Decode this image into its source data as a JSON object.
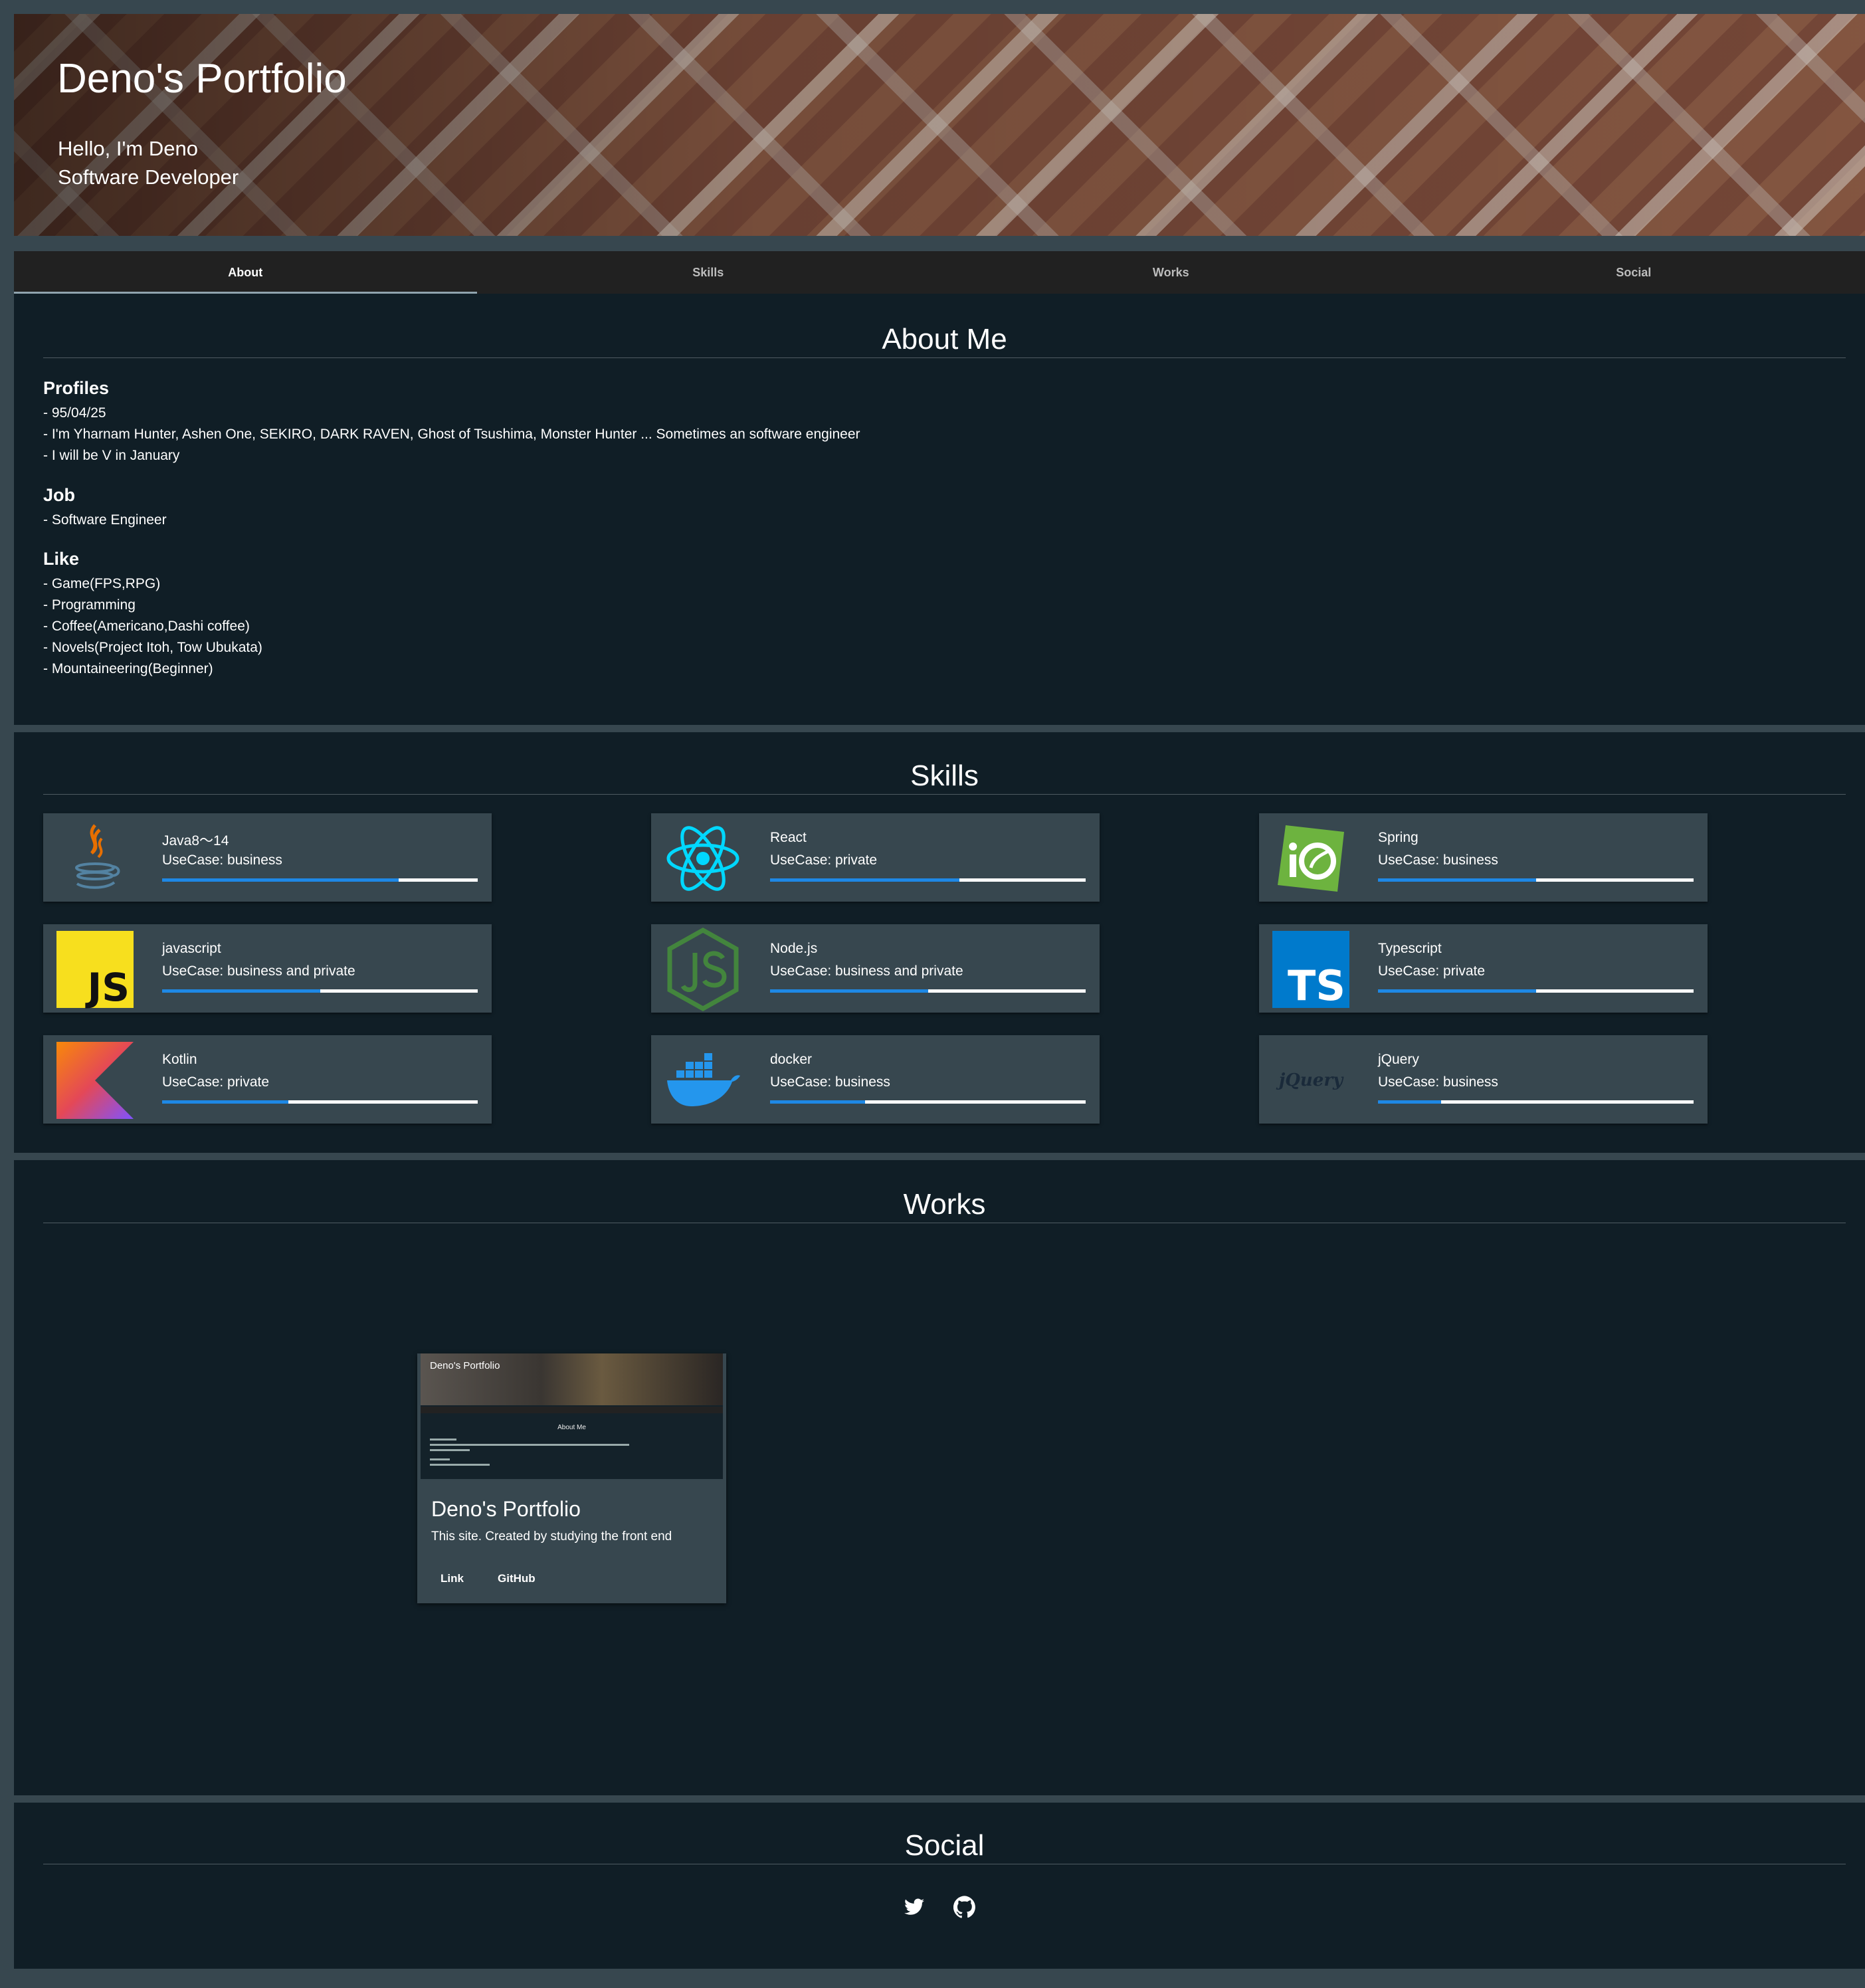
{
  "hero": {
    "title": "Deno's Portfolio",
    "greeting": "Hello, I'm Deno",
    "role": "Software Developer"
  },
  "tabs": [
    {
      "label": "About",
      "active": true
    },
    {
      "label": "Skills",
      "active": false
    },
    {
      "label": "Works",
      "active": false
    },
    {
      "label": "Social",
      "active": false
    }
  ],
  "about": {
    "title": "About Me",
    "profiles": {
      "heading": "Profiles",
      "lines": [
        "- 95/04/25",
        "- I'm Yharnam Hunter, Ashen One, SEKIRO, DARK RAVEN, Ghost of Tsushima, Monster Hunter ... Sometimes an software engineer",
        "- I will be V in January"
      ]
    },
    "job": {
      "heading": "Job",
      "lines": [
        "- Software Engineer"
      ]
    },
    "like": {
      "heading": "Like",
      "lines": [
        "- Game(FPS,RPG)",
        "- Programming",
        "- Coffee(Americano,Dashi coffee)",
        "- Novels(Project Itoh, Tow Ubukata)",
        "- Mountaineering(Beginner)"
      ]
    }
  },
  "skills": {
    "title": "Skills",
    "items": [
      {
        "name": "Java8〜14",
        "usecase": "UseCase: business",
        "level": 0.75,
        "icon": "java-icon"
      },
      {
        "name": "React",
        "usecase": "UseCase: private",
        "level": 0.6,
        "icon": "react-icon"
      },
      {
        "name": "Spring",
        "usecase": "UseCase: business",
        "level": 0.5,
        "icon": "spring-icon"
      },
      {
        "name": "javascript",
        "usecase": "UseCase: business and private",
        "level": 0.5,
        "icon": "javascript-icon"
      },
      {
        "name": "Node.js",
        "usecase": "UseCase: business and private",
        "level": 0.5,
        "icon": "nodejs-icon"
      },
      {
        "name": "Typescript",
        "usecase": "UseCase: private",
        "level": 0.5,
        "icon": "typescript-icon"
      },
      {
        "name": "Kotlin",
        "usecase": "UseCase: private",
        "level": 0.4,
        "icon": "kotlin-icon"
      },
      {
        "name": "docker",
        "usecase": "UseCase: business",
        "level": 0.3,
        "icon": "docker-icon"
      },
      {
        "name": "jQuery",
        "usecase": "UseCase: business",
        "level": 0.2,
        "icon": "jquery-icon"
      }
    ],
    "icon_labels": {
      "javascript": "JS",
      "typescript": "TS",
      "jquery": "jQuery"
    }
  },
  "works": {
    "title": "Works",
    "items": [
      {
        "title": "Deno's Portfolio",
        "description": "This site. Created by studying the front end",
        "link_label": "Link",
        "github_label": "GitHub",
        "thumb_title": "Deno's Portfolio",
        "thumb_section": "About Me"
      }
    ]
  },
  "social": {
    "title": "Social",
    "icons": [
      "twitter-icon",
      "github-icon"
    ]
  },
  "colors": {
    "page_bg": "#37474f",
    "section_bg": "#101e26",
    "card_bg": "#37474f",
    "tabs_bg": "#212121",
    "progress": "#1e88e5"
  }
}
